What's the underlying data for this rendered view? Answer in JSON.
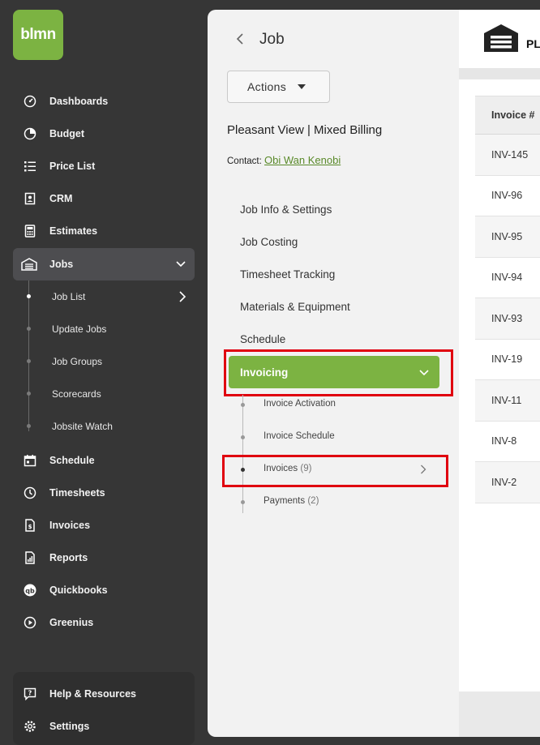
{
  "logo": {
    "text": "blmn"
  },
  "sidebar": {
    "items": [
      {
        "label": "Dashboards",
        "icon": "gauge-icon"
      },
      {
        "label": "Budget",
        "icon": "pie-chart-icon"
      },
      {
        "label": "Price List",
        "icon": "list-icon"
      },
      {
        "label": "CRM",
        "icon": "contact-card-icon"
      },
      {
        "label": "Estimates",
        "icon": "calculator-icon"
      },
      {
        "label": "Jobs",
        "icon": "warehouse-icon"
      }
    ],
    "jobs_sub": [
      "Job List",
      "Update Jobs",
      "Job Groups",
      "Scorecards",
      "Jobsite Watch"
    ],
    "items2": [
      {
        "label": "Schedule",
        "icon": "calendar-icon"
      },
      {
        "label": "Timesheets",
        "icon": "clock-icon"
      },
      {
        "label": "Invoices",
        "icon": "invoice-icon"
      },
      {
        "label": "Reports",
        "icon": "report-icon"
      },
      {
        "label": "Quickbooks",
        "icon": "quickbooks-icon"
      },
      {
        "label": "Greenius",
        "icon": "play-circle-icon"
      }
    ],
    "help": "Help & Resources",
    "settings": "Settings"
  },
  "job": {
    "title": "Job",
    "actions_label": "Actions",
    "name": "Pleasant View | Mixed Billing",
    "contact_label": "Contact:",
    "contact_name": "Obi Wan Kenobi",
    "menu": [
      "Job Info & Settings",
      "Job Costing",
      "Timesheet Tracking",
      "Materials & Equipment",
      "Schedule"
    ],
    "invoicing_label": "Invoicing",
    "invoicing_sub": {
      "activation": "Invoice Activation",
      "schedule": "Invoice Schedule",
      "invoices": "Invoices",
      "invoices_count": "(9)",
      "payments": "Payments",
      "payments_count": "(2)"
    }
  },
  "content": {
    "header_text": "PL",
    "table_header": "Invoice #",
    "rows": [
      "INV-145",
      "INV-96",
      "INV-95",
      "INV-94",
      "INV-93",
      "INV-19",
      "INV-11",
      "INV-8",
      "INV-2"
    ]
  },
  "colors": {
    "brand_green": "#7cb342",
    "highlight_red": "#e0000f",
    "sidebar_bg": "#363636"
  }
}
